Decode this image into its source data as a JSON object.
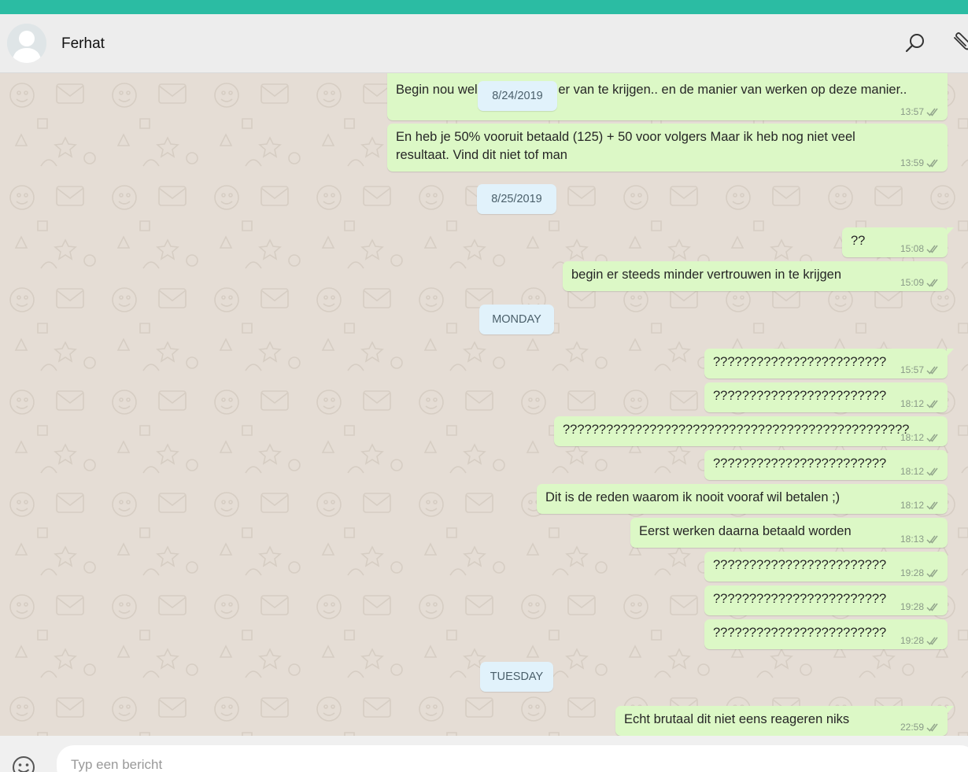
{
  "header": {
    "contact_name": "Ferhat",
    "icons": [
      "avatar-placeholder",
      "search-icon",
      "attach-icon"
    ]
  },
  "colors": {
    "top_strip": "#2bbca3",
    "chat_background": "#e5ddd5",
    "outgoing_bubble": "#dcf8c6",
    "date_pill": "#e1f2fb",
    "header_background": "#ededed"
  },
  "messages": [
    {
      "text": "Begin nou wel beetje stress er van te krijgen.. en de manier van werken op deze manier..",
      "time": "13:57"
    },
    {
      "text": "En heb je 50% vooruit betaald (125) + 50 voor volgers Maar ik heb nog niet veel resultaat. Vind dit niet tof man",
      "time": "13:59"
    },
    {
      "text": "??",
      "time": "15:08"
    },
    {
      "text": "begin er steeds minder vertrouwen in te krijgen",
      "time": "15:09"
    },
    {
      "text": "????????????????????????",
      "time": "15:57"
    },
    {
      "text": "????????????????????????",
      "time": "18:12"
    },
    {
      "text": "????????????????????????????????????????????????",
      "time": "18:12"
    },
    {
      "text": "????????????????????????",
      "time": "18:12"
    },
    {
      "text": "Dit is de reden waarom ik nooit vooraf wil betalen ;)",
      "time": "18:12"
    },
    {
      "text": "Eerst werken daarna betaald worden",
      "time": "18:13"
    },
    {
      "text": "????????????????????????",
      "time": "19:28"
    },
    {
      "text": "????????????????????????",
      "time": "19:28"
    },
    {
      "text": "????????????????????????",
      "time": "19:28"
    },
    {
      "text": "Echt brutaal dit niet eens reageren niks",
      "time": "22:59"
    }
  ],
  "date_separators": [
    "8/24/2019",
    "8/25/2019",
    "MONDAY",
    "TUESDAY"
  ],
  "composer": {
    "placeholder": "Typ een bericht",
    "icons": [
      "emoji-icon"
    ]
  }
}
